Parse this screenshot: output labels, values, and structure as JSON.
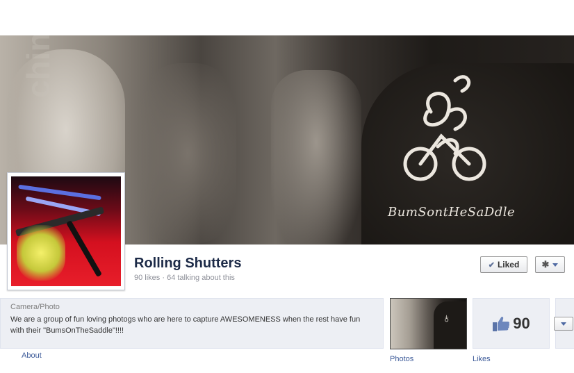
{
  "cover": {
    "shirt_text": "BumSontHeSaDdle",
    "watermark_text": "chin"
  },
  "page": {
    "title": "Rolling Shutters",
    "meta": "90 likes · 64 talking about this"
  },
  "actions": {
    "liked_label": "Liked"
  },
  "about": {
    "category": "Camera/Photo",
    "description": "We are a group of fun loving photogs who are here to capture AWESOMENESS when the rest have fun with their \"BumsOnTheSaddle\"!!!!",
    "link_label": "About"
  },
  "apps": {
    "photos_label": "Photos",
    "likes_label": "Likes",
    "likes_count": "90"
  },
  "colors": {
    "link": "#3b5998",
    "title": "#1c2a47",
    "panel_bg": "#edeff4"
  },
  "icons": [
    "check-icon",
    "gear-icon",
    "chevron-down-icon",
    "thumbs-up-icon"
  ]
}
